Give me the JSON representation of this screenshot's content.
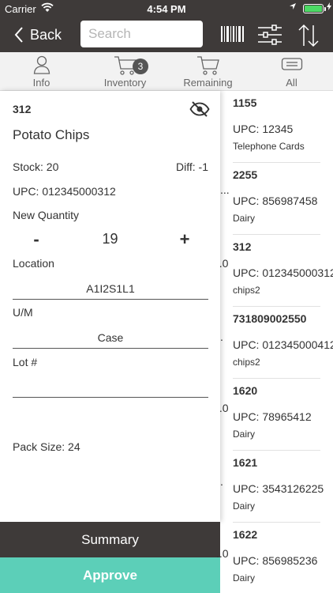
{
  "status": {
    "carrier": "Carrier",
    "time": "4:54 PM"
  },
  "nav": {
    "back_label": "Back",
    "search_placeholder": "Search"
  },
  "tabs": [
    {
      "label": "Info",
      "icon": "user-icon"
    },
    {
      "label": "Inventory",
      "icon": "cart-icon",
      "badge": "3"
    },
    {
      "label": "Remaining",
      "icon": "cart-icon"
    },
    {
      "label": "All",
      "icon": "list-icon"
    }
  ],
  "detail": {
    "code": "312",
    "name": "Potato Chips",
    "stock": "Stock: 20",
    "diff": "Diff: -1",
    "upc": "UPC: 012345000312",
    "new_quantity_label": "New Quantity",
    "minus": "-",
    "quantity": "19",
    "plus": "+",
    "location_label": "Location",
    "location_value": "A1I2S1L1",
    "um_label": "U/M",
    "um_value": "Case",
    "lot_label": "Lot #",
    "lot_value": "",
    "pack_size": "Pack Size: 24"
  },
  "buttons": {
    "summary": "Summary",
    "approve": "Approve"
  },
  "list": [
    {
      "code": "1155",
      "upc": "UPC:   12345",
      "category": "Telephone Cards",
      "peek": ""
    },
    {
      "code": "2255",
      "upc": "UPC:   856987458",
      "category": "Dairy",
      "peek": "..."
    },
    {
      "code": "312",
      "upc": "UPC:   012345000312",
      "category": "chips2",
      "peek": "...0"
    },
    {
      "code": "731809002550",
      "upc": "UPC:   012345000412",
      "category": "chips2",
      "peek": "."
    },
    {
      "code": "1620",
      "upc": "UPC:   78965412",
      "category": "Dairy",
      "peek": "..0"
    },
    {
      "code": "1621",
      "upc": "UPC:   3543126225",
      "category": "Dairy",
      "peek": "."
    },
    {
      "code": "1622",
      "upc": "UPC:   856985236",
      "category": "Dairy",
      "peek": "..0"
    }
  ],
  "colors": {
    "dark": "#3e3a39",
    "accent": "#5ccfb8",
    "battery": "#4cd964"
  }
}
